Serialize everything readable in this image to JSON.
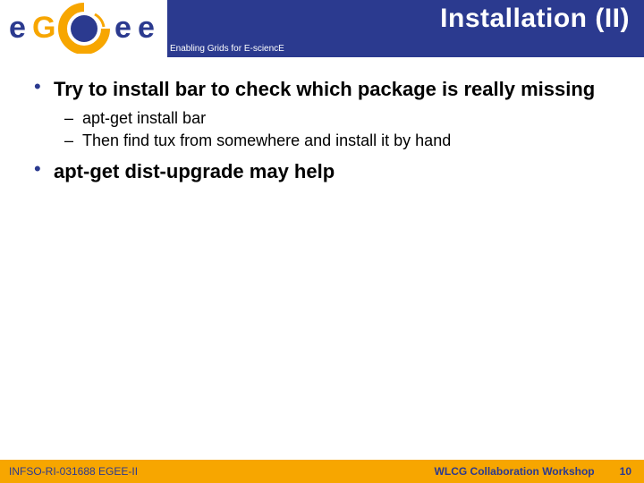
{
  "header": {
    "title": "Installation (II)",
    "tagline": "Enabling Grids for E-sciencE",
    "logo_text": "eGee"
  },
  "bullets": [
    {
      "text": "Try to install bar to check which package is really missing",
      "children": [
        "apt-get install bar",
        "Then find tux from somewhere and install it by hand"
      ]
    },
    {
      "text": "apt-get dist-upgrade may help",
      "children": []
    }
  ],
  "footer": {
    "left": "INFSO-RI-031688 EGEE-II",
    "conference": "WLCG Collaboration Workshop",
    "page": "10"
  }
}
